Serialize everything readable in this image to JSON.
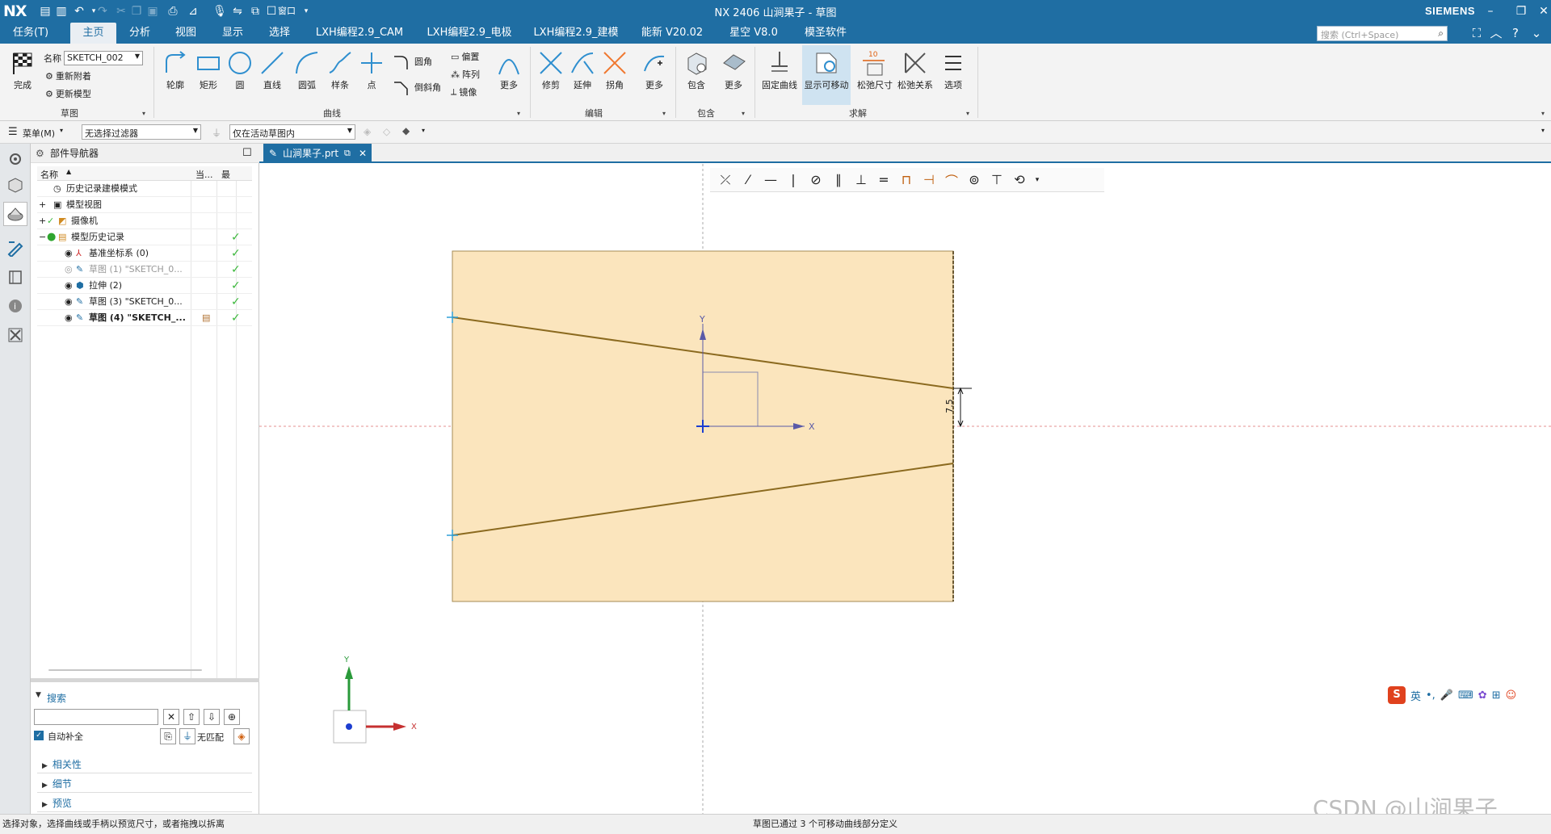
{
  "titlebar": {
    "logo": "NX",
    "window_menu_label": "窗口",
    "title": "NX 2406 山涧果子 - 草图",
    "brand": "SIEMENS"
  },
  "menubar": {
    "tabs": [
      "任务(T)",
      "主页",
      "分析",
      "视图",
      "显示",
      "选择",
      "LXH编程2.9_CAM",
      "LXH编程2.9_电极",
      "LXH编程2.9_建模",
      "能新 V20.02",
      "星空 V8.0",
      "模圣软件"
    ],
    "active_tab": "主页",
    "search_placeholder": "搜索 (Ctrl+Space)"
  },
  "ribbon": {
    "sketch_group": {
      "finish_label": "完成",
      "name_label": "名称",
      "sketch_name": "SKETCH_002",
      "reattach_label": "重新附着",
      "update_model_label": "更新模型",
      "group_label": "草图"
    },
    "curve_group": {
      "buttons": [
        "轮廓",
        "矩形",
        "圆",
        "直线",
        "圆弧",
        "样条",
        "点"
      ],
      "fillet_label": "圆角",
      "chamfer_label": "倒斜角",
      "offset_label": "偏置",
      "pattern_label": "阵列",
      "mirror_label": "镜像",
      "more_label": "更多",
      "group_label": "曲线"
    },
    "edit_group": {
      "buttons": [
        "修剪",
        "延伸",
        "拐角",
        "更多"
      ],
      "group_label": "编辑"
    },
    "include_group": {
      "buttons": [
        "包含",
        "更多"
      ],
      "group_label": "包含"
    },
    "solve_group": {
      "buttons": [
        "固定曲线",
        "显示可移动",
        "松弛尺寸",
        "松弛关系",
        "选项"
      ],
      "group_label": "求解",
      "relax_dim_value": "10"
    }
  },
  "filterbar": {
    "menu_label": "菜单(M)",
    "filter_value": "无选择过滤器",
    "scope_value": "仅在活动草图内"
  },
  "navigator": {
    "title": "部件导航器",
    "col_name": "名称",
    "col_current": "当...",
    "col_latest": "最",
    "rows": [
      {
        "label": "历史记录建模模式",
        "check": ""
      },
      {
        "label": "模型视图",
        "check": ""
      },
      {
        "label": "摄像机",
        "check": ""
      },
      {
        "label": "模型历史记录",
        "check": "✓"
      },
      {
        "label": "基准坐标系 (0)",
        "check": "✓"
      },
      {
        "label": "草图 (1) \"SKETCH_0...",
        "check": "✓"
      },
      {
        "label": "拉伸 (2)",
        "check": "✓"
      },
      {
        "label": "草图 (3) \"SKETCH_0...",
        "check": "✓"
      },
      {
        "label": "草图 (4) \"SKETCH_...",
        "check": "✓"
      }
    ],
    "search_label": "搜索",
    "autocomplete_label": "自动补全",
    "no_match_label": "无匹配",
    "sections": [
      "相关性",
      "细节",
      "预览"
    ]
  },
  "document_tab": {
    "label": "山涧果子.prt"
  },
  "graphics": {
    "dimension_value": "7.5",
    "axis_x": "X",
    "axis_y": "Y",
    "triad_x": "X",
    "triad_y": "Y"
  },
  "status": {
    "left": "选择对象，选择曲线或手柄以预览尺寸，或者拖拽以拆离",
    "center": "草图已通过 3 个可移动曲线部分定义"
  },
  "ime": {
    "lang": "英"
  },
  "watermark": "CSDN @山涧果子",
  "colors": {
    "accent": "#1f6ea3",
    "sketch_fill": "#fbe5bd",
    "sketch_line": "#8b6a1f",
    "check": "#3cb83c"
  }
}
